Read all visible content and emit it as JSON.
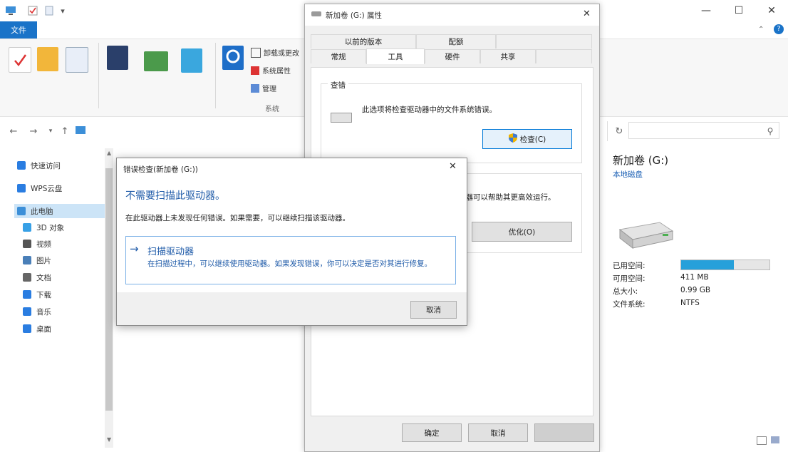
{
  "explorer": {
    "ribbon_file_tab": "文件",
    "ribbon_items": {
      "uninstall": "卸载或更改",
      "system_props": "系统属性",
      "manage": "管理",
      "group_system": "系统"
    },
    "nav": [
      {
        "label": "快速访问",
        "icon": "star-icon",
        "color": "#2a7de1"
      },
      {
        "label": "WPS云盘",
        "icon": "cloud-icon",
        "color": "#2a7de1"
      },
      {
        "label": "此电脑",
        "icon": "computer-icon",
        "color": "#3c8fd8",
        "selected": true
      },
      {
        "label": "3D 对象",
        "icon": "cube-icon",
        "color": "#37a0e6"
      },
      {
        "label": "视频",
        "icon": "video-icon",
        "color": "#555"
      },
      {
        "label": "图片",
        "icon": "picture-icon",
        "color": "#4a7fb8"
      },
      {
        "label": "文档",
        "icon": "document-icon",
        "color": "#666"
      },
      {
        "label": "下载",
        "icon": "download-icon",
        "color": "#2a7de1"
      },
      {
        "label": "音乐",
        "icon": "music-icon",
        "color": "#2a7de1"
      },
      {
        "label": "桌面",
        "icon": "desktop-icon",
        "color": "#2a7de1"
      }
    ],
    "details": {
      "drive_name": "新加卷 (G:)",
      "drive_type": "本地磁盘",
      "used_label": "已用空间:",
      "free_label": "可用空间:",
      "free_value": "411 MB",
      "total_label": "总大小:",
      "total_value": "0.99 GB",
      "fs_label": "文件系统:",
      "fs_value": "NTFS",
      "used_fraction": 0.6
    }
  },
  "properties": {
    "title": "新加卷 (G:) 属性",
    "tabs_row1": [
      "以前的版本",
      "配额"
    ],
    "tabs_row2": [
      "常规",
      "工具",
      "硬件",
      "共享"
    ],
    "active_tab": "工具",
    "check_group_title": "查错",
    "check_desc": "此选项将检查驱动器中的文件系统错误。",
    "check_button": "检查(C)",
    "optimize_desc": "……动器可以帮助其更高效运行。",
    "optimize_button": "优化(O)",
    "ok": "确定",
    "cancel": "取消"
  },
  "check_dialog": {
    "title": "错误检查(新加卷 (G:))",
    "heading": "不需要扫描此驱动器。",
    "desc": "在此驱动器上未发现任何错误。如果需要，可以继续扫描该驱动器。",
    "link_title": "扫描驱动器",
    "link_desc": "在扫描过程中，可以继续使用驱动器。如果发现错误，你可以决定是否对其进行修复。",
    "cancel": "取消"
  },
  "colors": {
    "accent": "#1a73c8",
    "heading_blue": "#1e5aa8",
    "bar_fill": "#26a0da"
  }
}
